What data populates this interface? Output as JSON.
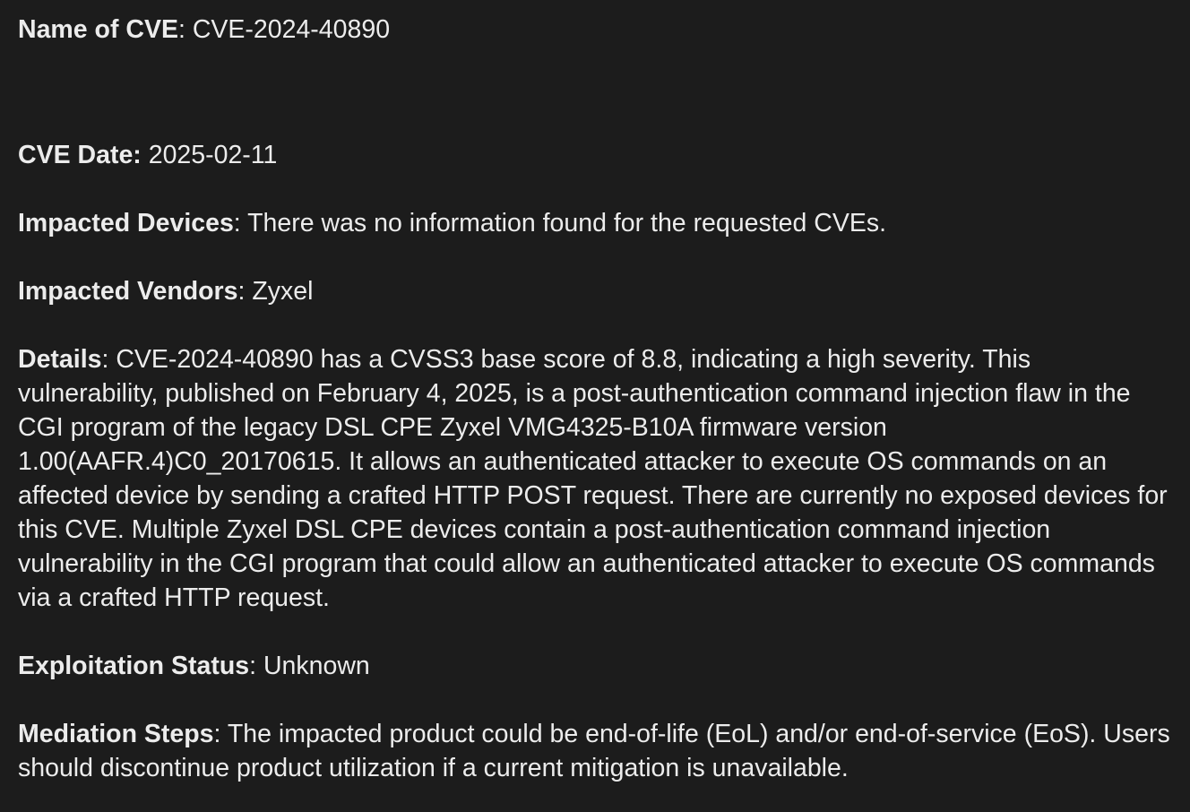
{
  "cve": {
    "name_label": "Name of CVE",
    "name_sep": ": ",
    "name_value": "CVE-2024-40890",
    "date_label": "CVE Date:",
    "date_sep": " ",
    "date_value": "2025-02-11",
    "devices_label": "Impacted Devices",
    "devices_sep": ": ",
    "devices_value": "There was no information found for the requested CVEs.",
    "vendors_label": "Impacted Vendors",
    "vendors_sep": ": ",
    "vendors_value": "Zyxel",
    "details_label": "Details",
    "details_sep": ": ",
    "details_value": "CVE-2024-40890 has a CVSS3 base score of 8.8, indicating a high severity. This vulnerability, published on February 4, 2025, is a post-authentication command injection flaw in the CGI program of the legacy DSL CPE Zyxel VMG4325-B10A firmware version 1.00(AAFR.4)C0_20170615. It allows an authenticated attacker to execute OS commands on an affected device by sending a crafted HTTP POST request. There are currently no exposed devices for this CVE. Multiple Zyxel DSL CPE devices contain a post-authentication command injection vulnerability in the CGI program that could allow an authenticated attacker to execute OS commands via a crafted HTTP request.",
    "exploitation_label": "Exploitation Status",
    "exploitation_sep": ": ",
    "exploitation_value": "Unknown",
    "mediation_label": "Mediation Steps",
    "mediation_sep": ": ",
    "mediation_value": "The impacted product could be end-of-life (EoL) and/or end-of-service (EoS). Users should discontinue product utilization if a current mitigation is unavailable."
  },
  "colors": {
    "background": "#1c1c1c",
    "text": "#ececec"
  }
}
